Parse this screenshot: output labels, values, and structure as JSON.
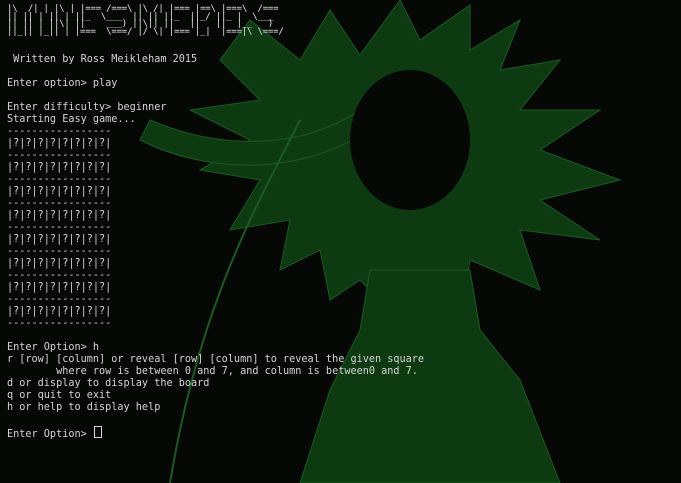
{
  "colors": {
    "background": "#050805",
    "foreground": "#d4d4d4",
    "wallpaper": "#0e3a12"
  },
  "banner": {
    "lines": [
      "|\\  /| | |\\ | |=== /===\\ |\\ /| |=== |==\\ |===\\  /===",
      "|| || | || | ||_  \\___  || || ||_  ||_/ ||_ |  \\___ ",
      "|| || | ||\\| ||    ___) ||\\|| ||   ||   ||  |__   ) ",
      "||_|| |_|| | |===  \\===/ |/ \\| |=== |_|  |===|\\ \\===/"
    ]
  },
  "author": " Written by Ross Meikleham 2015",
  "cmd1": {
    "prompt": "Enter option> ",
    "input": "play"
  },
  "cmd2": {
    "prompt": "Enter difficulty> ",
    "input": "beginner"
  },
  "starting": "Starting Easy game...",
  "board": {
    "separator": "-----------------",
    "rows": [
      "|?|?|?|?|?|?|?|?|",
      "|?|?|?|?|?|?|?|?|",
      "|?|?|?|?|?|?|?|?|",
      "|?|?|?|?|?|?|?|?|",
      "|?|?|?|?|?|?|?|?|",
      "|?|?|?|?|?|?|?|?|",
      "|?|?|?|?|?|?|?|?|",
      "|?|?|?|?|?|?|?|?|"
    ]
  },
  "cmd3": {
    "prompt": "Enter Option> ",
    "input": "h"
  },
  "help": [
    "r [row] [column] or reveal [row] [column] to reveal the given square",
    "        where row is between 0 and 7, and column is between0 and 7.",
    "d or display to display the board",
    "q or quit to exit",
    "h or help to display help"
  ],
  "cmd4": {
    "prompt": "Enter Option> ",
    "input": ""
  }
}
